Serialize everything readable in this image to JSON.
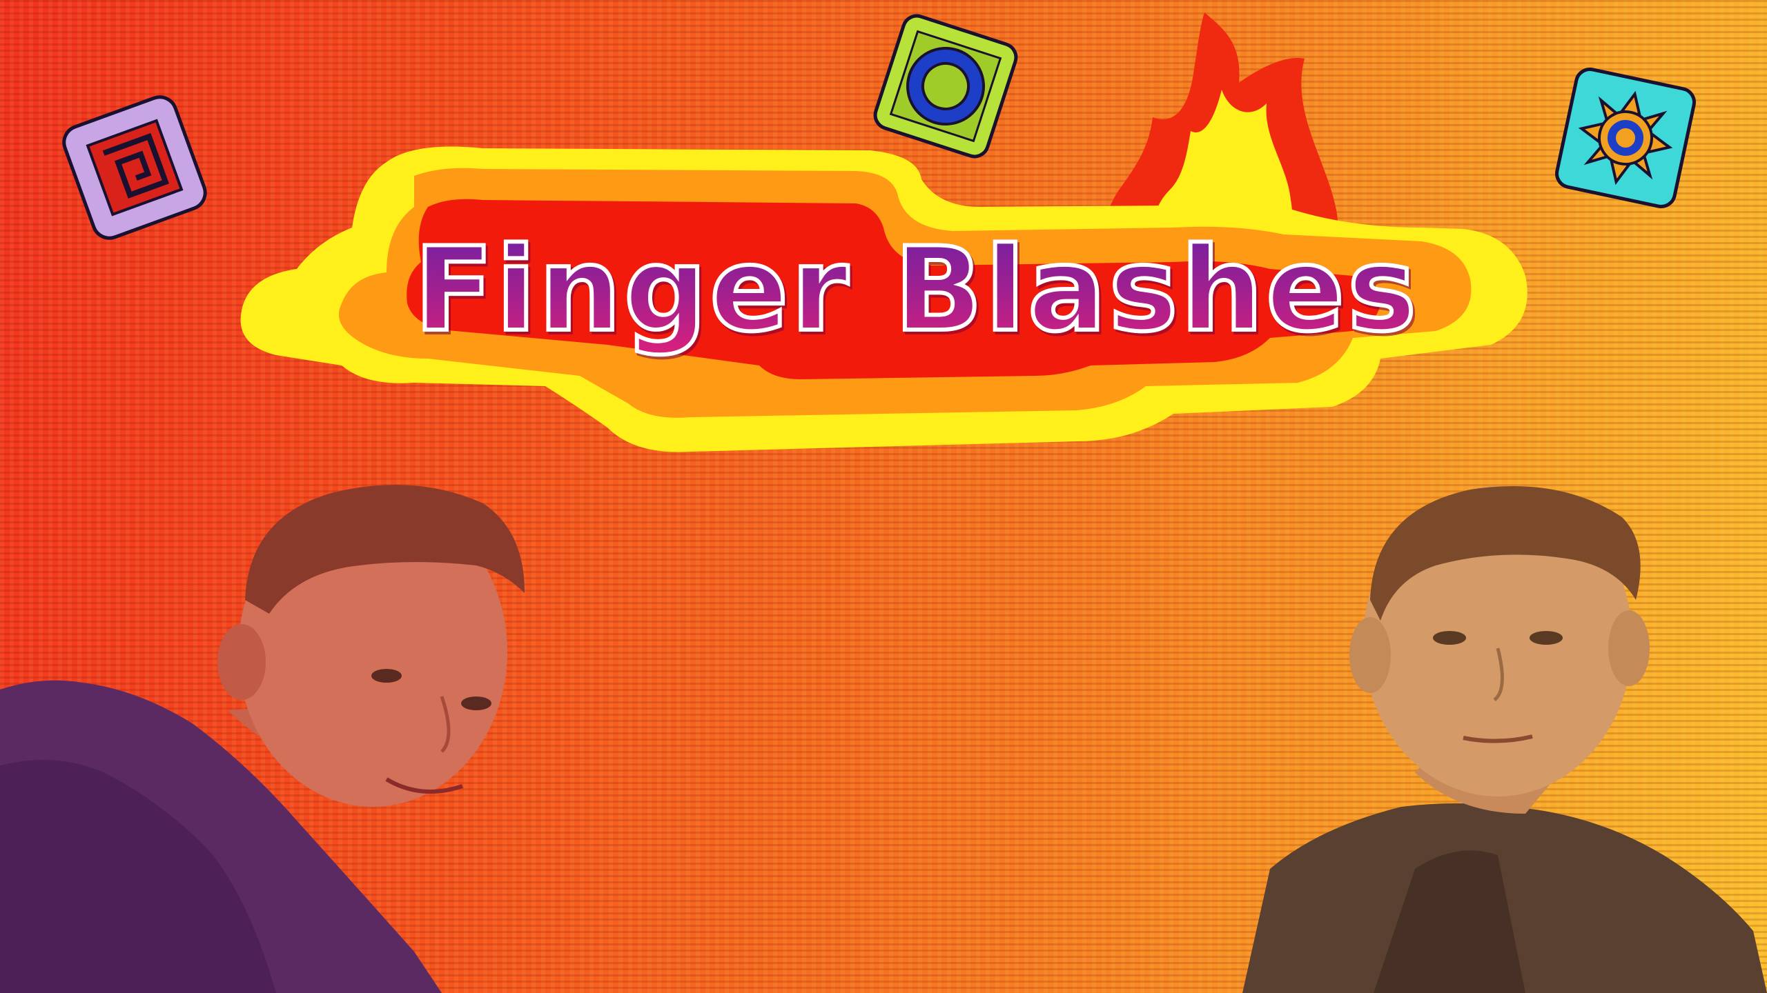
{
  "title": "Finger Blashes",
  "icons": [
    {
      "name": "square-spiral-icon",
      "color": "#c8a6e6"
    },
    {
      "name": "ring-icon",
      "color": "#b6e23a"
    },
    {
      "name": "sun-gear-icon",
      "color": "#3fd8d8"
    }
  ],
  "colors": {
    "background_left": "#f2321f",
    "background_right": "#fbc02f",
    "title_fill_top": "#6a1fa8",
    "title_fill_bottom": "#e0207a",
    "title_outline": "#ffffff",
    "blob_yellow": "#ffef1a",
    "blob_orange": "#ff9a14",
    "blob_red": "#f21a0a"
  }
}
